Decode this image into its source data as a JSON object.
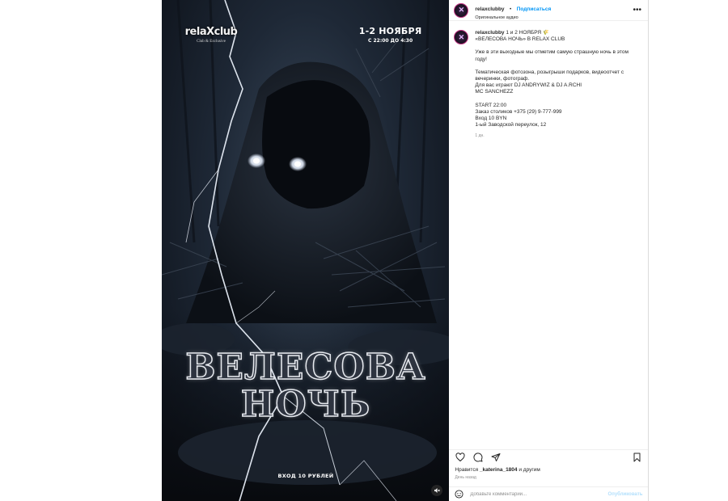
{
  "media": {
    "logo_text": "relaXclub",
    "logo_sub": "Club & Exclusive",
    "date_main": "1-2 НОЯБРЯ",
    "date_time": "С 22:00 ДО 4:30",
    "title_line1": "ВЕЛЕСОВА",
    "title_line2": "НОЧЬ",
    "price": "ВХОД 10 РУБЛЕЙ",
    "mute_icon": "speaker-muted-icon"
  },
  "header": {
    "username": "relaxclubby",
    "dot": "•",
    "follow_label": "Подписаться",
    "audio": "Оригинальное аудио",
    "more_icon": "more-horizontal-icon"
  },
  "caption": {
    "username": "relaxclubby",
    "line1": "1 и 2 НОЯБРЯ 🌾",
    "line2": "«ВЕЛЕСОВА НОЧЬ» В RELAX CLUB",
    "para1": "Уже в эти выходные мы отметим самую страшную ночь в этом году!",
    "para2_l1": "Тематическая фотозона, розыгрыши подарков, видеоотчет с вечеринки, фотограф.",
    "para2_l2": "Для вас играют DJ ANDRYWIZ & DJ A.RCHI",
    "para2_l3": "MC SANCHEZZ",
    "para3_l1": "START 22:00",
    "para3_l2": "Заказ столиков +375 (29) 9-777-999",
    "para3_l3": "Вход 10 BYN",
    "para3_l4": "1-ый Заводской переулок, 12",
    "timestamp": "1 дн."
  },
  "actions": {
    "like_icon": "heart-icon",
    "comment_icon": "comment-icon",
    "share_icon": "send-icon",
    "save_icon": "bookmark-icon"
  },
  "likes": {
    "prefix": "Нравится ",
    "user": "_katerina_1804",
    "suffix": " и другим"
  },
  "date_ago": "День назад",
  "comment": {
    "emoji_icon": "emoji-icon",
    "placeholder": "Добавьте комментарий...",
    "publish_label": "Опубликовать"
  },
  "colors": {
    "accent": "#0095f6",
    "publish_disabled": "#b2dffc",
    "muted_text": "#8e8e8e"
  }
}
